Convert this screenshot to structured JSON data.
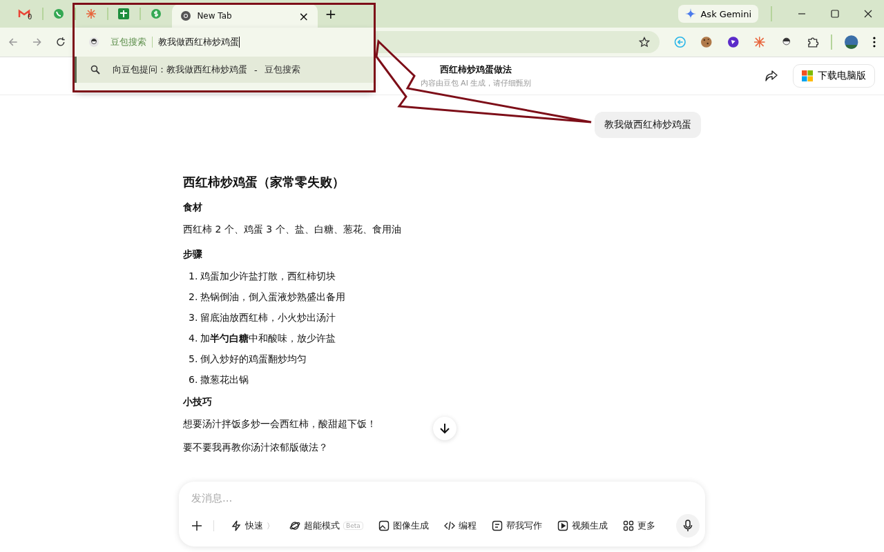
{
  "browser": {
    "tabs": [
      {
        "kind": "mail",
        "badge": "0",
        "selected": false
      },
      {
        "kind": "phone",
        "selected": false
      },
      {
        "kind": "burst",
        "selected": false
      },
      {
        "kind": "sheet",
        "selected": false
      },
      {
        "kind": "dollar",
        "selected": false
      },
      {
        "kind": "page",
        "label": "New Tab",
        "close": "×",
        "selected": true
      }
    ],
    "new_tab": "+",
    "ask": "Ask Gemini"
  },
  "omnibox": {
    "engine": "豆包搜索",
    "value": "教我做西红柿炒鸡蛋",
    "suggestion": "向豆包提问：教我做西红柿炒鸡蛋",
    "suggestion_separator": "-",
    "suggestion_source": "豆包搜索"
  },
  "page": {
    "title": "西红柿炒鸡蛋做法",
    "subtitle": "内容由豆包 AI 生成，请仔细甄别",
    "download": "下载电脑版"
  },
  "chat": {
    "user_message": "教我做西红柿炒鸡蛋",
    "answer": [
      {
        "kind": "heading",
        "text": "西红柿炒鸡蛋（家常零失败）"
      },
      {
        "kind": "label",
        "text": "食材"
      },
      {
        "kind": "para",
        "text": "西红柿 2 个、鸡蛋 3 个、盐、白糖、葱花、食用油"
      },
      {
        "kind": "label",
        "text": "步骤"
      },
      {
        "kind": "step",
        "number": "1.",
        "text": "鸡蛋加少许盐打散，西红柿切块"
      },
      {
        "kind": "step",
        "number": "2.",
        "text": "热锅倒油，倒入蛋液炒熟盛出备用"
      },
      {
        "kind": "step",
        "number": "3.",
        "text": "留底油放西红柿，小火炒出汤汁"
      },
      {
        "kind": "step",
        "number": "4.",
        "text": "加**半勺白糖**中和酸味，放少许盐"
      },
      {
        "kind": "step",
        "number": "5.",
        "text": "倒入炒好的鸡蛋翻炒均匀"
      },
      {
        "kind": "step",
        "number": "6.",
        "text": "撒葱花出锅"
      },
      {
        "kind": "label",
        "text": "小技巧"
      },
      {
        "kind": "para",
        "text": "想要汤汁拌饭多炒一会西红柿，酸甜超下饭！"
      },
      {
        "kind": "para",
        "text": "要不要我再教你汤汁浓郁版做法？"
      }
    ]
  },
  "composer": {
    "placeholder": "发消息...",
    "tools": [
      {
        "kind": "bolt",
        "label": "快速",
        "suffix": "〉"
      },
      {
        "kind": "planet",
        "label": "超能模式",
        "badge": "Beta"
      },
      {
        "kind": "image",
        "label": "图像生成"
      },
      {
        "kind": "code",
        "label": "编程"
      },
      {
        "kind": "write",
        "label": "帮我写作"
      },
      {
        "kind": "video",
        "label": "视频生成"
      },
      {
        "kind": "grid",
        "label": "更多"
      }
    ]
  }
}
